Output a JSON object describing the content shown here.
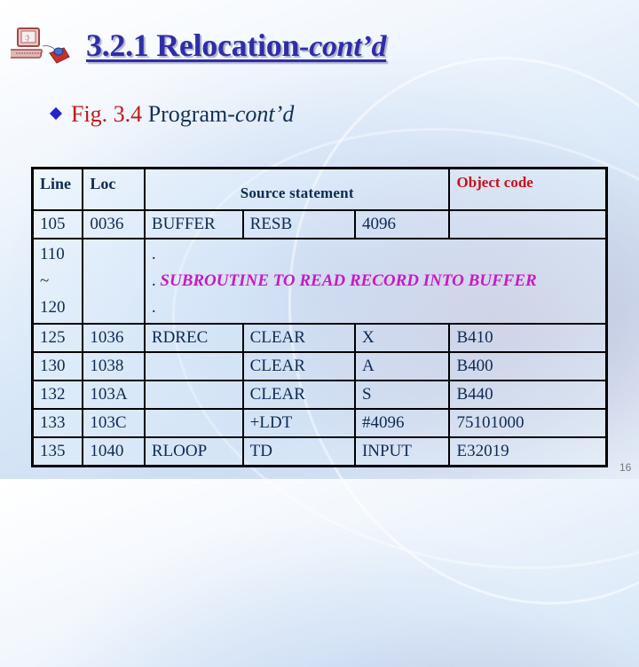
{
  "slide": {
    "title_main": "3.2.1 Relocation",
    "title_suffix": "-cont’d",
    "bullet": {
      "icon": "diamond-bullet-icon",
      "fig_label": "Fig. 3.4",
      "text_main": " Program-",
      "text_italic": "cont’d"
    },
    "page_number": "16",
    "colors": {
      "title": "#2e2ea8",
      "fig_label": "#c01818",
      "object_code_header": "#c8101c",
      "comment": "#c818c8",
      "body_text": "#0d2a55"
    }
  },
  "table": {
    "headers": {
      "line": "Line",
      "loc": "Loc",
      "source": "Source statement",
      "object": "Object code"
    },
    "rows": [
      {
        "line": "105",
        "loc": "0036",
        "label": "BUFFER",
        "op": "RESB",
        "operand": "4096",
        "obj": ""
      },
      {
        "comment": true,
        "line_start": "110",
        "line_sep": "~",
        "line_end": "120",
        "loc": "",
        "dot1": ".",
        "dot2": ".",
        "comment_text": "SUBROUTINE TO READ RECORD INTO BUFFER",
        "dot3": "."
      },
      {
        "line": "125",
        "loc": "1036",
        "label": "RDREC",
        "op": "CLEAR",
        "operand": "X",
        "obj": "B410"
      },
      {
        "line": "130",
        "loc": "1038",
        "label": "",
        "op": "CLEAR",
        "operand": "A",
        "obj": "B400"
      },
      {
        "line": "132",
        "loc": "103A",
        "label": "",
        "op": "CLEAR",
        "operand": "S",
        "obj": "B440"
      },
      {
        "line": "133",
        "loc": "103C",
        "label": "",
        "op": "+LDT",
        "operand": "#4096",
        "obj": "75101000"
      },
      {
        "line": "135",
        "loc": "1040",
        "label": "RLOOP",
        "op": "TD",
        "operand": "INPUT",
        "obj": "E32019"
      }
    ]
  }
}
